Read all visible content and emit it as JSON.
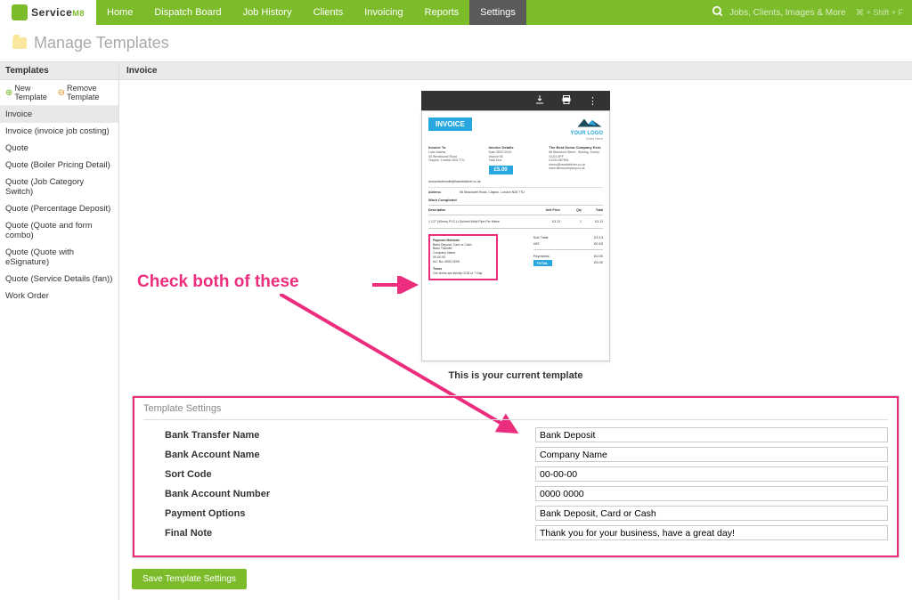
{
  "nav": {
    "items": [
      "Home",
      "Dispatch Board",
      "Job History",
      "Clients",
      "Invoicing",
      "Reports",
      "Settings"
    ],
    "activeIndex": 6
  },
  "search": {
    "placeholder": "Jobs, Clients, Images & More",
    "shortcut": "⌘ + Shift + F"
  },
  "page_title": "Manage Templates",
  "sidebar": {
    "header": "Templates",
    "new_label": "New Template",
    "remove_label": "Remove Template",
    "items": [
      "Invoice",
      "Invoice (invoice job costing)",
      "Quote",
      "Quote (Boiler Pricing Detail)",
      "Quote (Job Category Switch)",
      "Quote (Percentage Deposit)",
      "Quote (Quote and form combo)",
      "Quote (Quote with eSignature)",
      "Quote (Service Details (fan))",
      "Work Order"
    ],
    "selectedIndex": 0
  },
  "content": {
    "header": "Invoice",
    "preview": {
      "badge": "INVOICE",
      "logo_label": "YOUR LOGO",
      "logo_sub": "Goes Here",
      "invoice_to_title": "Invoice To",
      "invoice_to_text": "Luke Adams\n90 Westbound Road\nClayton, London N26 7TU",
      "invoice_details_title": "Invoice Details",
      "invoice_details_text": "Date   28/07/2019\nInvoice  56\nTotal Due",
      "amount": "£5.00",
      "company_title": "The Best Demo Company Ever.",
      "company_text": "58 Blackford Street , Woking, Surrey\nGU21 6PF\n01234 567891\ndemo@hazelwitcher.co.uk\nwww.democompany.co.uk",
      "email_label": "accountsdemoltd@hazelwitcher.co.uk",
      "address_label": "Address",
      "address_text": "58 Strachwell Road, Clayton, London N26 7TU",
      "work_completed_label": "Work Completed",
      "table_headers": {
        "desc": "Description",
        "price": "Unit Price",
        "qty": "Qty",
        "total": "Total"
      },
      "table_row": {
        "desc": "1 1/2\" (40mm) PVC-U Solvent Weld Pipe Per Metre",
        "price": "£3.13",
        "qty": "1",
        "total": "£3.13"
      },
      "payment_methods_title": "Payment Methods",
      "payment_methods_text": "Bank Deposit, Card or Cash\nBank Transfer\nCompany Name\n00-00-00\nA/C No: 0000 0000",
      "terms_title": "Terms",
      "terms_text": "Our terms are strictly COD or 7 Day",
      "subtotal_label": "Sub Total:",
      "subtotal": "£3.13",
      "vat_label": "VAT:",
      "vat": "£0.63",
      "payments_label": "Payments:",
      "payments": "£0.00",
      "total_label": "TOTAL",
      "total": "£5.00"
    },
    "caption": "This is your current template"
  },
  "annotation": "Check both of these",
  "settings": {
    "title": "Template Settings",
    "rows": [
      {
        "label": "Bank Transfer Name",
        "value": "Bank Deposit"
      },
      {
        "label": "Bank Account Name",
        "value": "Company Name"
      },
      {
        "label": "Sort Code",
        "value": "00-00-00"
      },
      {
        "label": "Bank Account Number",
        "value": "0000 0000"
      },
      {
        "label": "Payment Options",
        "value": "Bank Deposit, Card or Cash"
      },
      {
        "label": "Final Note",
        "value": "Thank you for your business, have a great day!"
      }
    ],
    "save_label": "Save Template Settings"
  },
  "logo": {
    "brand": "Service",
    "suffix": "M8"
  }
}
